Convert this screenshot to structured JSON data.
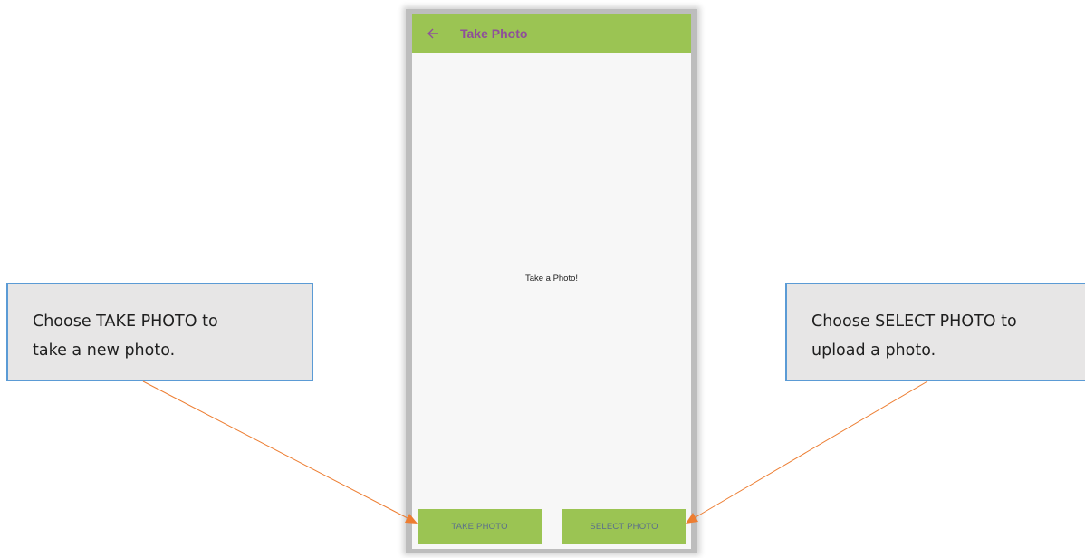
{
  "app_bar": {
    "title": "Take Photo",
    "back_icon": "arrow-left-icon",
    "background_color": "#9bc453",
    "title_color": "#8f4f9a"
  },
  "main": {
    "message": "Take a Photo!"
  },
  "buttons": {
    "take_photo": "TAKE PHOTO",
    "select_photo": "SELECT PHOTO"
  },
  "callouts": {
    "left": {
      "line1": "Choose TAKE PHOTO to",
      "line2": "take a new photo."
    },
    "right": {
      "line1": "Choose SELECT PHOTO to",
      "line2": "upload a photo."
    }
  },
  "colors": {
    "accent_green": "#9bc453",
    "callout_border": "#5b9bd5",
    "callout_fill": "#e7e6e6",
    "arrow": "#ed7d31"
  }
}
